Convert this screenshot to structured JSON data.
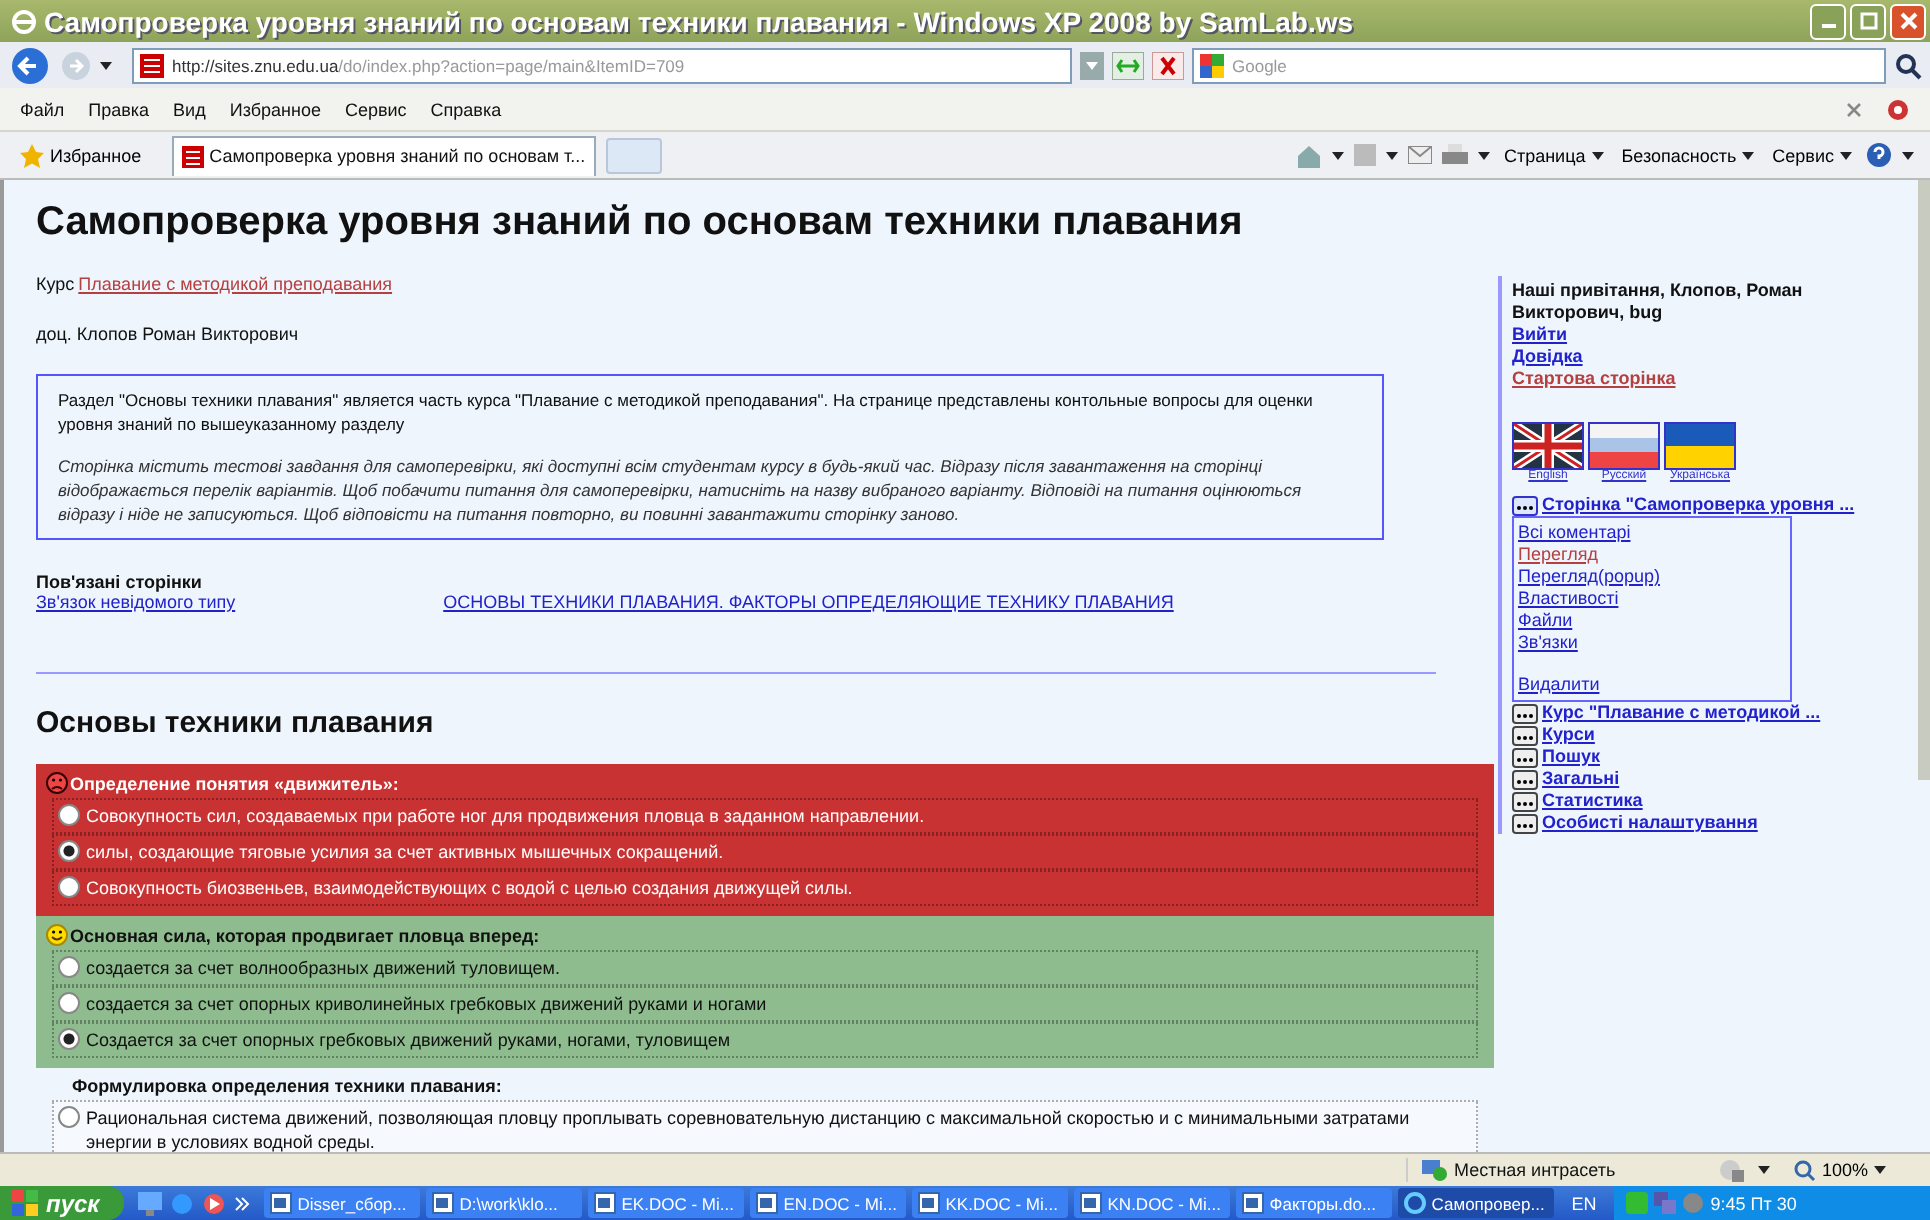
{
  "window": {
    "title": "Самопроверка уровня знаний по основам техники плавания - Windows XP 2008 by SamLab.ws"
  },
  "address_bar": {
    "url_host": "http://sites.znu.edu.ua",
    "url_path": "/do/index.php?action=page/main&ItemID=709",
    "search_placeholder": "Google"
  },
  "menu": [
    "Файл",
    "Правка",
    "Вид",
    "Избранное",
    "Сервис",
    "Справка"
  ],
  "favorites": {
    "label": "Избранное"
  },
  "tabs": [
    {
      "label": "Самопроверка уровня знаний по основам т...",
      "selected": true
    }
  ],
  "command_bar": [
    "Страница",
    "Безопасность",
    "Сервис"
  ],
  "page": {
    "title": "Самопроверка уровня знаний по основам техники плавания",
    "course_label": "Курс",
    "course_link": "Плавание с методикой преподавания",
    "teacher": "доц. Клопов Роман Викторович",
    "description": "Раздел \"Основы техники плавания\" является часть курса \"Плавание с методикой преподавания\". На странице представлены контольные вопросы для оценки уровня знаний по вышеуказанному разделу",
    "note": "Сторінка містить тестові завдання для самоперевірки, які доступні всім студентам курсу в будь-який час. Відразу після завантаження на сторінці відображається перелік варіантів. Щоб побачити питання для самоперевірки, натисніть на назву вибраного варіанту. Відповіді на питання оцінюються відразу і ніде не записуються. Щоб відповісти на питання повторно, ви повинні завантажити сторінку заново.",
    "related": {
      "heading": "Пов'язані сторінки",
      "links": [
        "Зв'язок невідомого типу",
        "ОСНОВЫ ТЕХНИКИ ПЛАВАНИЯ. ФАКТОРЫ ОПРЕДЕЛЯЮЩИЕ ТЕХНИКУ ПЛАВАНИЯ"
      ]
    },
    "section_title": "Основы техники плавания",
    "questions": [
      {
        "text": "Определение понятия «движитель»:",
        "kind": "wrong",
        "options": [
          {
            "text": "Совокупность сил, создаваемых при работе ног для продвижения пловца в заданном направлении.",
            "selected": false
          },
          {
            "text": "силы, создающие тяговые усилия за счет активных мышечных сокращений.",
            "selected": true
          },
          {
            "text": "Совокупность биозвеньев, взаимодействующих с водой с целью создания движущей силы.",
            "selected": false
          }
        ]
      },
      {
        "text": "Основная сила, которая продвигает пловца вперед:",
        "kind": "correct",
        "options": [
          {
            "text": "создается за счет волнообразных движений туловищем.",
            "selected": false
          },
          {
            "text": "создается за счет опорных криволинейных гребковых движений руками и ногами",
            "selected": false
          },
          {
            "text": "Создается за счет опорных гребковых движений руками, ногами, туловищем",
            "selected": true
          }
        ]
      },
      {
        "text": "Формулировка определения техники плавания:",
        "kind": "plain",
        "options": [
          {
            "text": "Рациональная система движений, позволяющая пловцу проплывать соревновательную дистанцию с максимальной скоростью и с минимальными затратами энергии в условиях водной среды.",
            "selected": false
          }
        ]
      }
    ]
  },
  "sidebar": {
    "greeting": "Наші привітання, Клопов, Роман Викторович, bug",
    "links": [
      {
        "text": "Вийти",
        "kind": "link"
      },
      {
        "text": "Довідка",
        "kind": "link"
      },
      {
        "text": "Стартова сторінка",
        "kind": "visited"
      }
    ],
    "languages": [
      {
        "label": "English",
        "kind": "en"
      },
      {
        "label": "Русский",
        "kind": "ru"
      },
      {
        "label": "Українська",
        "kind": "ua"
      }
    ],
    "blocks": [
      {
        "label": "Сторінка \"Самопроверка уровня ...",
        "expanded": true,
        "children": [
          {
            "text": "Всі коментарі",
            "kind": "link",
            "spaced": false
          },
          {
            "text": "Перегляд",
            "kind": "visited",
            "spaced": false
          },
          {
            "text": "Перегляд(popup)",
            "kind": "link",
            "spaced": false
          },
          {
            "text": "Властивості",
            "kind": "link",
            "spaced": false
          },
          {
            "text": "Файли",
            "kind": "link",
            "spaced": false
          },
          {
            "text": "Зв'язки",
            "kind": "link",
            "spaced": false
          },
          {
            "text": "Видалити",
            "kind": "link",
            "spaced": true
          }
        ]
      },
      {
        "label": "Курс \"Плавание с методикой ...",
        "expanded": false
      },
      {
        "label": "Курси",
        "expanded": false
      },
      {
        "label": "Пошук",
        "expanded": false
      },
      {
        "label": "Загальні",
        "expanded": false
      },
      {
        "label": "Статистика",
        "expanded": false
      },
      {
        "label": "Особисті налаштування",
        "expanded": false
      }
    ]
  },
  "status_bar": {
    "zone": "Местная интрасеть",
    "zoom": "100%"
  },
  "taskbar": {
    "start": "пуск",
    "tasks": [
      {
        "label": "Disser_сбор...",
        "selected": false
      },
      {
        "label": "D:\\work\\klo...",
        "selected": false
      },
      {
        "label": "EK.DOC - Mi...",
        "selected": false
      },
      {
        "label": "EN.DOC - Mi...",
        "selected": false
      },
      {
        "label": "KK.DOC - Mi...",
        "selected": false
      },
      {
        "label": "KN.DOC - Mi...",
        "selected": false
      },
      {
        "label": "Факторы.do...",
        "selected": false
      },
      {
        "label": "Самопровер...",
        "selected": true
      }
    ],
    "lang": "EN",
    "clock": "9:45 Пт 30"
  }
}
